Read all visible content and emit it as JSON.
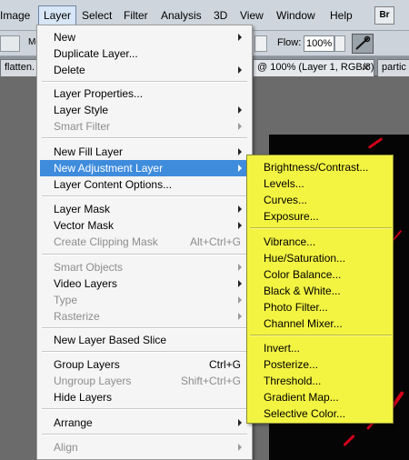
{
  "menubar": {
    "items": [
      "Image",
      "Layer",
      "Select",
      "Filter",
      "Analysis",
      "3D",
      "View",
      "Window",
      "Help"
    ],
    "active": "Layer",
    "badge": "Br"
  },
  "options_bar": {
    "left_text": "Mo",
    "flow_label": "Flow:",
    "flow_value": "100%"
  },
  "tabs": [
    {
      "label": "flatten."
    },
    {
      "label": "@ 100% (Layer 1, RGB/8)"
    },
    {
      "label": "partic"
    }
  ],
  "layer_menu": {
    "groups": [
      [
        {
          "label": "New",
          "submenu": true
        },
        {
          "label": "Duplicate Layer..."
        },
        {
          "label": "Delete",
          "submenu": true
        }
      ],
      [
        {
          "label": "Layer Properties..."
        },
        {
          "label": "Layer Style",
          "submenu": true
        },
        {
          "label": "Smart Filter",
          "submenu": true,
          "disabled": true
        }
      ],
      [
        {
          "label": "New Fill Layer",
          "submenu": true
        },
        {
          "label": "New Adjustment Layer",
          "submenu": true,
          "highlighted": true
        },
        {
          "label": "Layer Content Options..."
        }
      ],
      [
        {
          "label": "Layer Mask",
          "submenu": true
        },
        {
          "label": "Vector Mask",
          "submenu": true
        },
        {
          "label": "Create Clipping Mask",
          "shortcut": "Alt+Ctrl+G",
          "disabled": true
        }
      ],
      [
        {
          "label": "Smart Objects",
          "submenu": true,
          "disabled": true
        },
        {
          "label": "Video Layers",
          "submenu": true
        },
        {
          "label": "Type",
          "submenu": true,
          "disabled": true
        },
        {
          "label": "Rasterize",
          "submenu": true,
          "disabled": true
        }
      ],
      [
        {
          "label": "New Layer Based Slice"
        }
      ],
      [
        {
          "label": "Group Layers",
          "shortcut": "Ctrl+G"
        },
        {
          "label": "Ungroup Layers",
          "shortcut": "Shift+Ctrl+G",
          "disabled": true
        },
        {
          "label": "Hide Layers"
        }
      ],
      [
        {
          "label": "Arrange",
          "submenu": true
        }
      ],
      [
        {
          "label": "Align",
          "submenu": true,
          "disabled": true
        }
      ]
    ]
  },
  "adjustment_submenu": {
    "background": "#f3f441",
    "groups": [
      [
        "Brightness/Contrast...",
        "Levels...",
        "Curves...",
        "Exposure..."
      ],
      [
        "Vibrance...",
        "Hue/Saturation...",
        "Color Balance...",
        "Black & White...",
        "Photo Filter...",
        "Channel Mixer..."
      ],
      [
        "Invert...",
        "Posterize...",
        "Threshold...",
        "Gradient Map...",
        "Selective Color..."
      ]
    ]
  },
  "colors": {
    "highlight": "#3f8cdd",
    "submenu_highlight": "#f3f441",
    "canvas_streaks": "#d4001a"
  }
}
